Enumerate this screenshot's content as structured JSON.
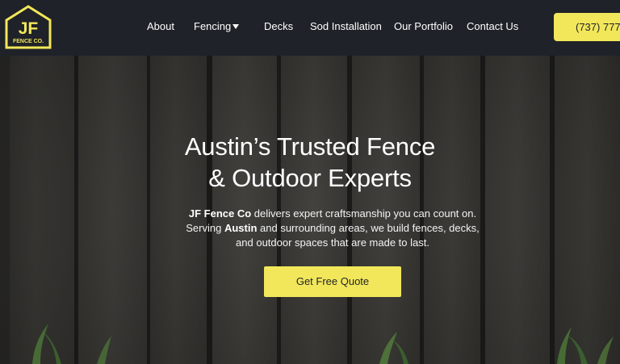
{
  "logo": {
    "letters": "JF",
    "subtitle": "FENCE CO.",
    "color": "#f2e75a"
  },
  "nav": {
    "about": "About",
    "fencing": "Fencing",
    "decks": "Decks",
    "sod": "Sod Installation",
    "portfolio": "Our Portfolio",
    "contact": "Contact Us",
    "dropdown_icon": "caret-down-icon"
  },
  "phone_button": {
    "label": "(737) 777-"
  },
  "hero": {
    "title_line1": "Austin’s Trusted Fence",
    "title_line2": "& Outdoor Experts",
    "description": {
      "brand": "JF Fence Co",
      "part1": " delivers expert craftsmanship you can count on.",
      "part2": "Serving ",
      "city": "Austin",
      "part3": " and surrounding areas, we build fences, decks,",
      "part4": "and outdoor spaces that are made to last."
    },
    "cta_label": "Get Free Quote"
  },
  "colors": {
    "accent": "#f2e75a",
    "navbar": "#1f2228",
    "text": "#ffffff"
  }
}
